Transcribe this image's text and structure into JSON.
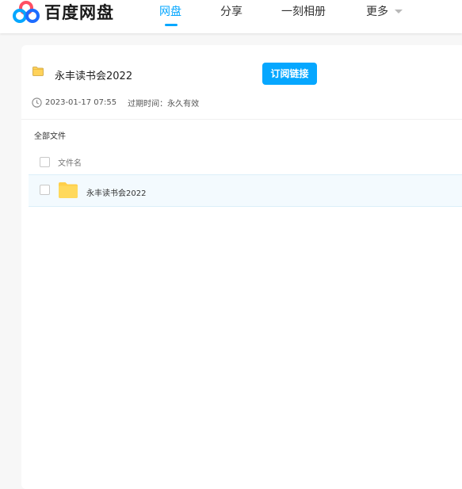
{
  "header": {
    "logo_text": "百度网盘",
    "nav": [
      {
        "label": "网盘"
      },
      {
        "label": "分享"
      },
      {
        "label": "一刻相册"
      },
      {
        "label": "更多"
      }
    ],
    "active_nav": "网盘",
    "accent_color": "#06a7ff"
  },
  "share": {
    "title": "永丰读书会2022",
    "subscribe_label": "订阅链接",
    "date": "2023-01-17 07:55",
    "expire": "过期时间：永久有效"
  },
  "list": {
    "breadcrumb": "全部文件",
    "column_header": "文件名",
    "files": [
      {
        "name": "永丰读书会2022",
        "type": "folder"
      }
    ]
  }
}
